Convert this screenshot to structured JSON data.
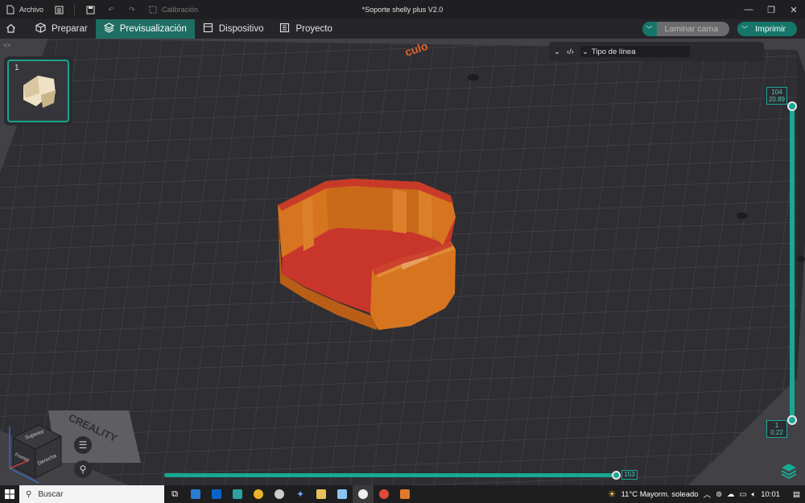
{
  "titlebar": {
    "file_menu": "Archivo",
    "calibration": "Calibración",
    "document_title": "*Soporte shelly plus V2.0"
  },
  "menubar": {
    "tabs": [
      {
        "label": "Preparar",
        "icon": "cube-icon",
        "active": false
      },
      {
        "label": "Previsualización",
        "icon": "layers-icon",
        "active": true
      },
      {
        "label": "Dispositivo",
        "icon": "device-icon",
        "active": false
      },
      {
        "label": "Proyecto",
        "icon": "project-icon",
        "active": false
      }
    ],
    "slice_label": "Laminar cama",
    "print_label": "Imprimir"
  },
  "viewport": {
    "plate_number": "1",
    "line_type_label": "Tipo de línea",
    "bed_brand": "CREALITY",
    "bed_corner_text": "culo",
    "layer_top": {
      "layer": "104",
      "height": "20.89"
    },
    "layer_bottom": {
      "layer": "1",
      "height": "0.22"
    },
    "move_value": "153",
    "nav_cube": {
      "top": "Superior",
      "front": "Frontal",
      "right": "Derecha"
    }
  },
  "taskbar": {
    "search_placeholder": "Buscar",
    "weather": "11°C  Mayorm. soleado",
    "time": "10:01"
  },
  "colors": {
    "accent": "#18a893",
    "active_tab": "#1f6e63",
    "wall_orange": "#d7741c",
    "infill_red": "#c8352a"
  }
}
